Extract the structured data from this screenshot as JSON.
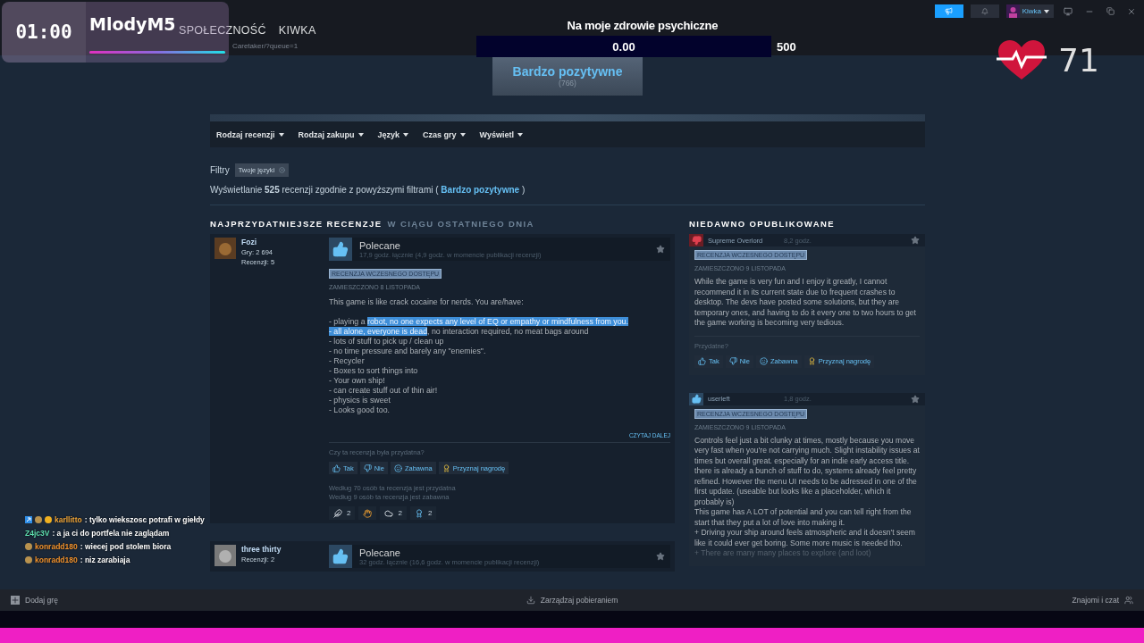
{
  "stream_timer": {
    "time": "01:00",
    "streamer": "MlodyM5",
    "level": 1
  },
  "nav": [
    "SPOŁECZNOŚĆ",
    "KIWKA"
  ],
  "url": "Caretaker/?queue=1",
  "account": {
    "name": "Kiwka"
  },
  "goal": {
    "title": "Na moje zdrowie psychiczne",
    "amount": "0.00",
    "target": "500",
    "level": 0
  },
  "heart_rate": {
    "bpm": "71"
  },
  "rating": {
    "label": "Bardzo pozytywne",
    "count": "(766)"
  },
  "filters": [
    "Rodzaj recenzji",
    "Rodzaj zakupu",
    "Język",
    "Czas gry",
    "Wyświetl"
  ],
  "active_filters": {
    "label": "Filtry",
    "chips": [
      "Twoje języki"
    ]
  },
  "summary": {
    "before": "Wyświetlanie **525** recenzji zgodnie z powyższymi filtrami (",
    "link": "Bardzo pozytywne",
    "after": ")"
  },
  "helpful": {
    "title": "NAJPRZYDATNIEJSZE RECENZJE",
    "period": "W CIĄGU OSTATNIEGO DNIA",
    "reviews": [
      {
        "author": "Fozi",
        "games": "Gry: 2 694",
        "count": "Recenzji: 5",
        "verdict": "Polecane",
        "recommended": true,
        "hours": "17,9 godz. łącznie (4,9 godz. w momencie publikacji recenzji)",
        "tag": "RECENZJA WCZESNEGO DOSTĘPU",
        "posted": "ZAMIESZCZONO 8 LISTOPADA",
        "paragraphs": [
          [
            [
              {
                "text": "This game is like crack cocaine for nerds. You are/have:",
                "selected": false
              }
            ]
          ],
          [
            [
              {
                "text": "- playing a ",
                "selected": false
              },
              {
                "text": "robot, no one expects any level of EQ or empathy or mindfulness from you.",
                "selected": true
              }
            ],
            [
              {
                "text": "- all alone, everyone is dead",
                "selected": true
              },
              {
                "text": ", no interaction required, no meat bags around",
                "selected": false
              }
            ],
            [
              {
                "text": "- lots of stuff to pick up / clean up",
                "selected": false
              }
            ],
            [
              {
                "text": "- no time pressure and barely any \"enemies\".",
                "selected": false
              }
            ],
            [
              {
                "text": "- Recycler",
                "selected": false
              }
            ],
            [
              {
                "text": "- Boxes to sort things into",
                "selected": false
              }
            ],
            [
              {
                "text": "- Your own ship!",
                "selected": false
              }
            ],
            [
              {
                "text": "- can create stuff out of thin air!",
                "selected": false
              }
            ],
            [
              {
                "text": "- physics is sweet",
                "selected": false
              }
            ],
            [
              {
                "text": "- Looks good too.",
                "selected": false
              }
            ]
          ]
        ],
        "read_more": "CZYTAJ DALEJ",
        "question": "Czy ta recenzja była przydatna?",
        "votes": [
          {
            "kind": "yes",
            "label": "Tak"
          },
          {
            "kind": "no",
            "label": "Nie"
          },
          {
            "kind": "funny",
            "label": "Zabawna"
          },
          {
            "kind": "award",
            "label": "Przyznaj nagrodę"
          }
        ],
        "stats": [
          "Według 70 osób ta recenzja jest przydatna",
          "Według 9 osób ta recenzja jest zabawna"
        ],
        "awards": [
          {
            "kind": "wings",
            "count": "2"
          },
          {
            "kind": "hand"
          },
          {
            "kind": "cloud",
            "count": "2"
          },
          {
            "kind": "ribbon",
            "count": "2"
          }
        ]
      },
      {
        "author": "three thirty",
        "count": "Recenzji: 2",
        "verdict": "Polecane",
        "recommended": true,
        "hours": "32 godz. łącznie (16,6 godz. w momencie publikacji recenzji)"
      }
    ]
  },
  "recent": {
    "title": "NIEDAWNO OPUBLIKOWANE",
    "reviews": [
      {
        "author": "Supreme Overlord",
        "recommended": false,
        "hours": "8,2 godz.",
        "tag": "RECENZJA WCZESNEGO DOSTĘPU",
        "posted": "ZAMIESZCZONO 9 LISTOPADA",
        "body": [
          "While the game is very fun and I enjoy it greatly, I cannot recommend it in its current state due to frequent crashes to desktop. The devs have posted some solutions, but they are temporary ones, and having to do it every one to two hours to get the game working is becoming very tedious."
        ],
        "question": "Przydatne?",
        "votes": [
          {
            "kind": "yes",
            "label": "Tak"
          },
          {
            "kind": "no",
            "label": "Nie"
          },
          {
            "kind": "funny",
            "label": "Zabawna"
          },
          {
            "kind": "award",
            "label": "Przyznaj nagrodę"
          }
        ]
      },
      {
        "author": "userleft",
        "recommended": true,
        "hours": "1,8 godz.",
        "tag": "RECENZJA WCZESNEGO DOSTĘPU",
        "posted": "ZAMIESZCZONO 9 LISTOPADA",
        "body": [
          "Controls feel just a bit clunky at times, mostly because you move very fast when you're not carrying much. Slight instability issues at times but overall great. especially for an indie early access title. there is already a bunch of stuff to do, systems already feel pretty refined. However the menu UI needs to be adressed in one of the first update. (useable but looks like a placeholder, which it probably is)",
          "This game has A LOT of potential and you can tell right from the start that they put a lot of love into making it.",
          "+ Driving your ship around feels atmospheric and it doesn't seem like it could ever get boring. Some more music is needed tho.",
          "+ There are many many places to explore (and loot)"
        ]
      }
    ]
  },
  "chat": [
    {
      "user": "karllitto",
      "color": "#f0a63a",
      "kind": "supporter",
      "text": ": tylko wiekszosc potrafi w giełdy"
    },
    {
      "user": "Z4jc3V",
      "color": "#5fe0b0",
      "kind": "plain",
      "text": ": a ja ci do portfela nie zaglądam"
    },
    {
      "user": "konradd180",
      "color": "#f0922e",
      "kind": "member",
      "text": ": wiecej pod stolem biora"
    },
    {
      "user": "konradd180",
      "color": "#f0922e",
      "kind": "member",
      "text": ": niz zarabiaja"
    }
  ],
  "footer": {
    "add_game": "Dodaj grę",
    "downloads": "Zarządzaj pobieraniem",
    "friends": "Znajomi i czat"
  }
}
